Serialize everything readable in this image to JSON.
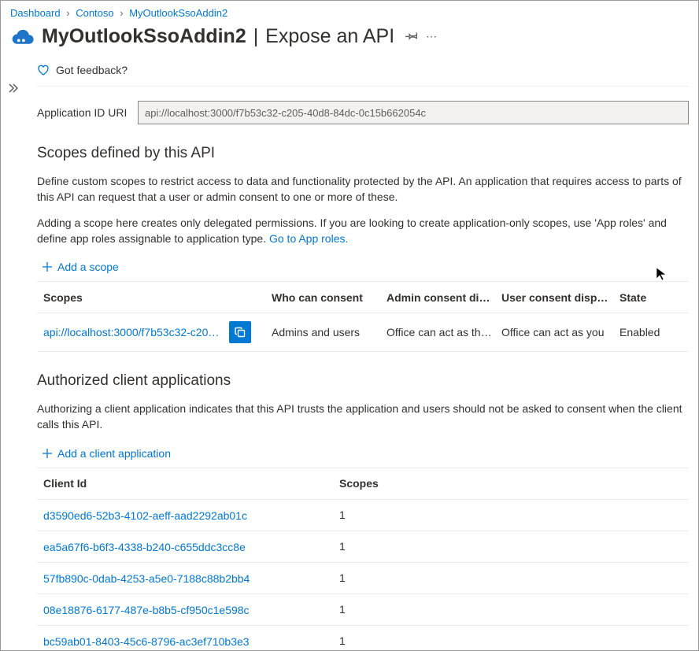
{
  "breadcrumb": {
    "items": [
      "Dashboard",
      "Contoso",
      "MyOutlookSsoAddin2"
    ]
  },
  "header": {
    "app_name": "MyOutlookSsoAddin2",
    "page_name": "Expose an API"
  },
  "feedback": {
    "label": "Got feedback?"
  },
  "app_id_uri": {
    "label": "Application ID URI",
    "value": "api://localhost:3000/f7b53c32-c205-40d8-84dc-0c15b662054c"
  },
  "scopes_section": {
    "title": "Scopes defined by this API",
    "desc1": "Define custom scopes to restrict access to data and functionality protected by the API. An application that requires access to parts of this API can request that a user or admin consent to one or more of these.",
    "desc2_a": "Adding a scope here creates only delegated permissions. If you are looking to create application-only scopes, use 'App roles' and define app roles assignable to application type. ",
    "desc2_link": "Go to App roles.",
    "add_label": "Add a scope",
    "headers": {
      "scope": "Scopes",
      "who": "Who can consent",
      "admin": "Admin consent disp…",
      "user": "User consent displa…",
      "state": "State"
    },
    "rows": [
      {
        "scope": "api://localhost:3000/f7b53c32-c205-40d…",
        "who": "Admins and users",
        "admin": "Office can act as the u…",
        "user": "Office can act as you",
        "state": "Enabled"
      }
    ]
  },
  "clients_section": {
    "title": "Authorized client applications",
    "desc": "Authorizing a client application indicates that this API trusts the application and users should not be asked to consent when the client calls this API.",
    "add_label": "Add a client application",
    "headers": {
      "client": "Client Id",
      "scopes": "Scopes"
    },
    "rows": [
      {
        "client": "d3590ed6-52b3-4102-aeff-aad2292ab01c",
        "scopes": "1"
      },
      {
        "client": "ea5a67f6-b6f3-4338-b240-c655ddc3cc8e",
        "scopes": "1"
      },
      {
        "client": "57fb890c-0dab-4253-a5e0-7188c88b2bb4",
        "scopes": "1"
      },
      {
        "client": "08e18876-6177-487e-b8b5-cf950c1e598c",
        "scopes": "1"
      },
      {
        "client": "bc59ab01-8403-45c6-8796-ac3ef710b3e3",
        "scopes": "1"
      }
    ]
  }
}
